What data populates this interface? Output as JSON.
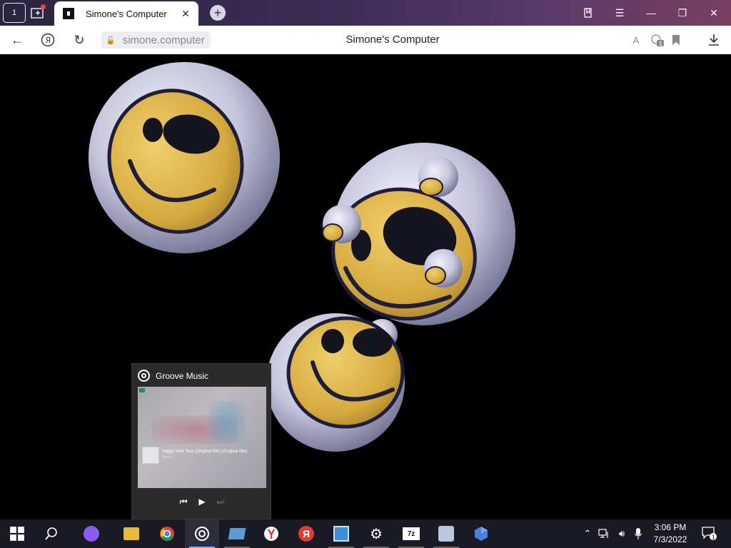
{
  "browser": {
    "tab_count": "1",
    "tab_title": "Simone's Computer",
    "url": "simone.computer",
    "page_title": "Simone's Computer",
    "translate_label": "A",
    "extensions_badge": "1"
  },
  "groove": {
    "app_name": "Groove Music",
    "song": "Happy New Year (Original Mix) (Original Mix)",
    "artist": "Tesco"
  },
  "taskbar": {
    "apps": [
      "start",
      "search",
      "alice",
      "file-explorer",
      "chrome",
      "groove-music",
      "app-window",
      "yandex-browser",
      "yandex",
      "control-panel",
      "settings",
      "7-zip",
      "app-tool",
      "app-hex"
    ],
    "time": "3:06 PM",
    "date": "7/3/2022",
    "notifications_badge": "1"
  },
  "colors": {
    "accent": "#8fa8ff",
    "smiley_yellow": "#e0b94a",
    "sphere": "#c8c8dc"
  }
}
